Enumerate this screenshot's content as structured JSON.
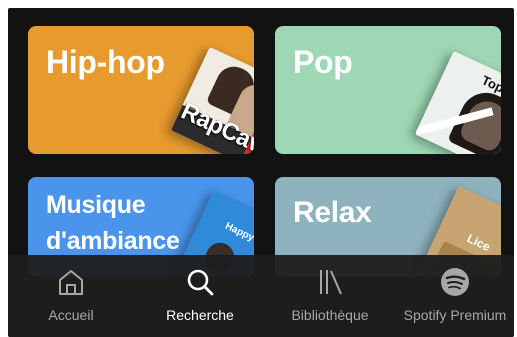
{
  "categories": [
    {
      "title": "Hip-hop",
      "color": "#e79a2e",
      "cover_text": "RapCav"
    },
    {
      "title": "Pop",
      "color": "#9ed7b3",
      "cover_text": "Top H"
    },
    {
      "title": "Musique d'ambiance",
      "color": "#4a95eb",
      "cover_text": "Happy"
    },
    {
      "title": "Relax",
      "color": "#8eb3bf",
      "cover_text": "Lice"
    }
  ],
  "nav": {
    "items": [
      {
        "label": "Accueil",
        "icon": "home-icon",
        "active": false
      },
      {
        "label": "Recherche",
        "icon": "search-icon",
        "active": true
      },
      {
        "label": "Bibliothèque",
        "icon": "library-icon",
        "active": false
      },
      {
        "label": "Spotify Premium",
        "icon": "spotify-icon",
        "active": false
      }
    ]
  },
  "colors": {
    "background": "#121212",
    "nav_active": "#ffffff",
    "nav_inactive": "#a7a7a7"
  }
}
